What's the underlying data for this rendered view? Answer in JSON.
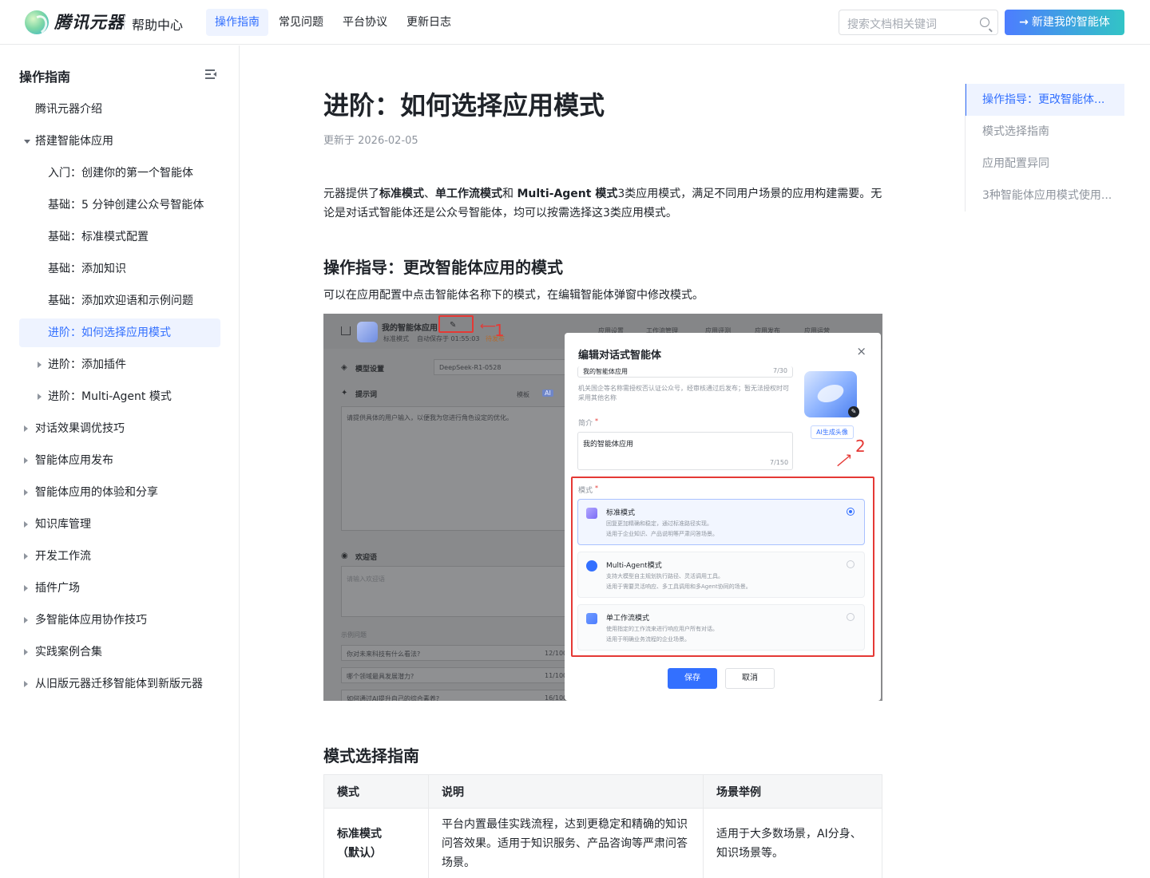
{
  "header": {
    "brand": "腾讯元器",
    "section": "帮助中心",
    "nav": [
      "操作指南",
      "常见问题",
      "平台协议",
      "更新日志"
    ],
    "active_nav": 0,
    "search_placeholder": "搜索文档相关键词",
    "new_button": "新建我的智能体"
  },
  "sidebar": {
    "title": "操作指南",
    "items": [
      {
        "label": "腾讯元器介绍",
        "level": 1,
        "caret": "none"
      },
      {
        "label": "搭建智能体应用",
        "level": 1,
        "caret": "down"
      },
      {
        "label": "入门：创建你的第一个智能体",
        "level": 2,
        "caret": "none"
      },
      {
        "label": "基础：5 分钟创建公众号智能体",
        "level": 2,
        "caret": "none"
      },
      {
        "label": "基础：标准模式配置",
        "level": 2,
        "caret": "none"
      },
      {
        "label": "基础：添加知识",
        "level": 2,
        "caret": "none"
      },
      {
        "label": "基础：添加欢迎语和示例问题",
        "level": 2,
        "caret": "none"
      },
      {
        "label": "进阶：如何选择应用模式",
        "level": 2,
        "caret": "none",
        "active": true
      },
      {
        "label": "进阶：添加插件",
        "level": 2,
        "caret": "right"
      },
      {
        "label": "进阶：Multi-Agent 模式",
        "level": 2,
        "caret": "right"
      },
      {
        "label": "对话效果调优技巧",
        "level": 1,
        "caret": "right"
      },
      {
        "label": "智能体应用发布",
        "level": 1,
        "caret": "right"
      },
      {
        "label": "智能体应用的体验和分享",
        "level": 1,
        "caret": "right"
      },
      {
        "label": "知识库管理",
        "level": 1,
        "caret": "right"
      },
      {
        "label": "开发工作流",
        "level": 1,
        "caret": "right"
      },
      {
        "label": "插件广场",
        "level": 1,
        "caret": "right"
      },
      {
        "label": "多智能体应用协作技巧",
        "level": 1,
        "caret": "right"
      },
      {
        "label": "实践案例合集",
        "level": 1,
        "caret": "right"
      },
      {
        "label": "从旧版元器迁移智能体到新版元器",
        "level": 1,
        "caret": "right"
      }
    ]
  },
  "article": {
    "title": "进阶：如何选择应用模式",
    "updated": "更新于 2026-02-05",
    "intro_parts": [
      {
        "text": "元器提供了",
        "bold": false
      },
      {
        "text": "标准模式",
        "bold": true
      },
      {
        "text": "、",
        "bold": false
      },
      {
        "text": "单工作流模式",
        "bold": true
      },
      {
        "text": "和 ",
        "bold": false
      },
      {
        "text": "Multi-Agent 模式",
        "bold": true
      },
      {
        "text": "3类应用模式，满足不同用户场景的应用构建需要。无论是对话式智能体还是公众号智能体，均可以按需选择这3类应用模式。",
        "bold": false
      }
    ],
    "h2_guide": "操作指导：更改智能体应用的模式",
    "guide_text": "可以在应用配置中点击智能体名称下的模式，在编辑智能体弹窗中修改模式。",
    "h2_table": "模式选择指南",
    "table": {
      "headers": [
        "模式",
        "说明",
        "场景举例"
      ],
      "rows": [
        {
          "mode": "标准模式\n（默认）",
          "desc": "平台内置最佳实践流程，达到更稳定和精确的知识问答效果。适用于知识服务、产品咨询等严肃问答场景。",
          "example": "适用于大多数场景，AI分身、知识场景等。"
        }
      ]
    }
  },
  "screenshot": {
    "app_name": "我的智能体应用",
    "mode_tag": "标准模式",
    "autosave": "自动保存于 01:55:03",
    "unpublished": "待发布",
    "top_tabs": [
      "应用设置",
      "工作流管理",
      "应用评测",
      "应用发布",
      "应用运营"
    ],
    "model_label": "模型设置",
    "model_value": "DeepSeek-R1-0528",
    "prompt_label": "提示词",
    "prompt_template": "模板",
    "prompt_ai": "AI",
    "prompt_text": "请提供具体的用户输入，以便我为您进行角色设定的优化。",
    "welcome_label": "欢迎语",
    "welcome_placeholder": "请输入欢迎语",
    "examples_label": "示例问题",
    "examples": [
      {
        "q": "你对未来科技有什么看法?",
        "count": "12/100"
      },
      {
        "q": "哪个领域最具发展潜力?",
        "count": "11/100"
      },
      {
        "q": "如何通过AI提升自己的综合素养?",
        "count": "16/100"
      }
    ],
    "marker1": "1",
    "marker2": "2",
    "dialog": {
      "title": "编辑对话式智能体",
      "close": "×",
      "name_value": "我的智能体应用",
      "name_count": "7/30",
      "name_hint": "机关国企等名称需授权否认证公众号，经审核通过后发布；暂无法授权时可采用其他名称",
      "intro_label": "简介",
      "intro_value": "我的智能体应用",
      "intro_count": "7/150",
      "ai_avatar": "AI生成头像",
      "mode_label": "模式",
      "modes": [
        {
          "name": "标准模式",
          "desc1": "回复更加精确和稳定，通过标准路径实现。",
          "desc2": "适用于企业知识、产品说明等严肃问答场景。",
          "selected": true,
          "color": "#7b6cf6"
        },
        {
          "name": "Multi-Agent模式",
          "desc1": "支持大模型自主规划执行路径、灵活调用工具。",
          "desc2": "适用于需要灵活响应、多工具调用和多Agent协同的场景。",
          "selected": false,
          "color": "#3370ff"
        },
        {
          "name": "单工作流模式",
          "desc1": "使用指定的工作流来进行响应用户所有对话。",
          "desc2": "适用于明确业务流程的企业场景。",
          "selected": false,
          "color": "#4d7dff"
        }
      ],
      "save": "保存",
      "cancel": "取消"
    }
  },
  "toc": {
    "items": [
      "操作指导：更改智能体...",
      "模式选择指南",
      "应用配置异同",
      "3种智能体应用模式使用..."
    ],
    "active": 0
  },
  "colors": {
    "accent": "#3370ff",
    "active_bg": "#eef3ff",
    "annotation_red": "#e53935"
  }
}
